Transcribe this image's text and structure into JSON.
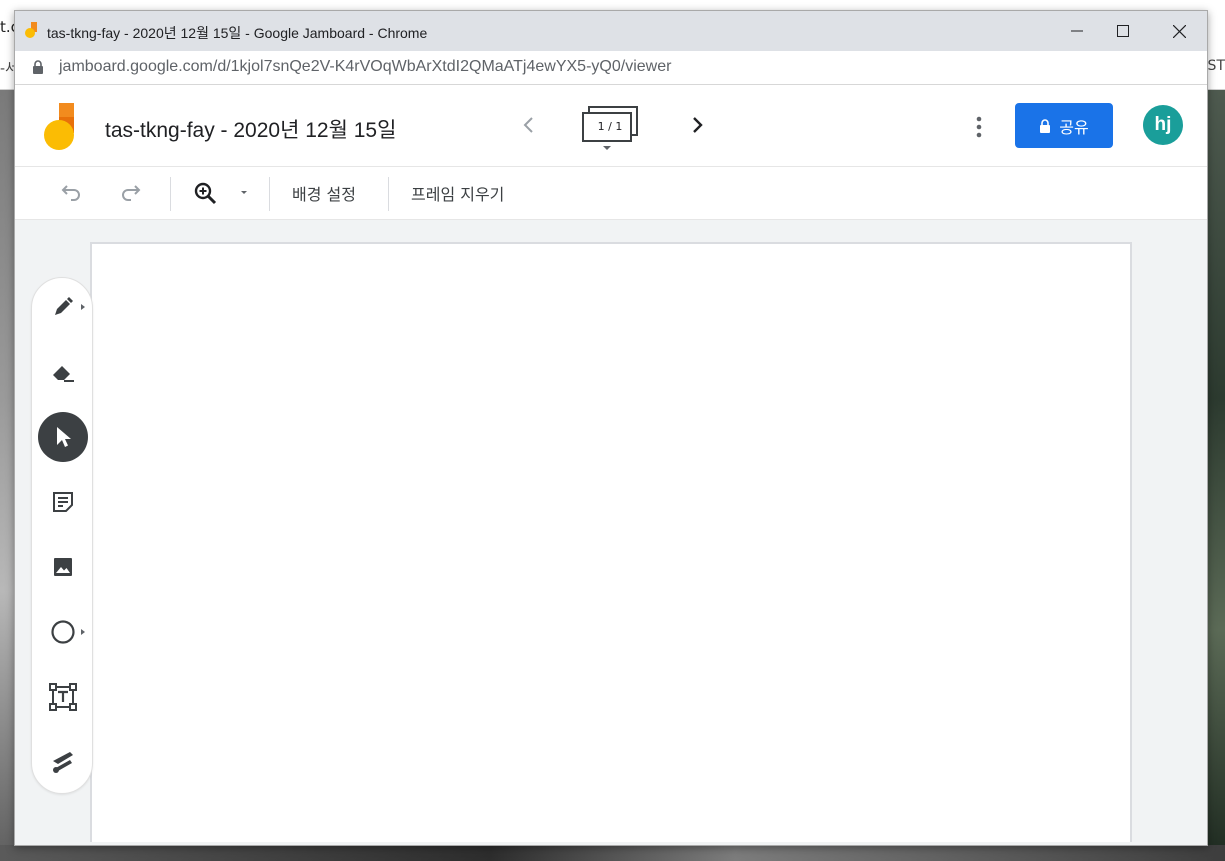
{
  "desktop": {
    "fragment_left_top": "t.c",
    "fragment_left_mid": "-서",
    "fragment_right_mid": "IST"
  },
  "browser": {
    "window_title": "tas-tkng-fay - 2020년 12월 15일 - Google Jamboard - Chrome",
    "url": "jamboard.google.com/d/1kjol7snQe2V-K4rVOqWbArXtdI2QMaATj4ewYX5-yQ0/viewer"
  },
  "app": {
    "doc_title": "tas-tkng-fay - 2020년 12월 15일",
    "frame_label": "1 / 1",
    "share_label": "공유",
    "avatar_initials": "hj",
    "colors": {
      "share": "#1a73e8",
      "avatar": "#1a9e9a",
      "logo_orange": "#f28b1e",
      "logo_yellow": "#fbbc04"
    }
  },
  "toolbar": {
    "undo_icon": "undo-icon",
    "redo_icon": "redo-icon",
    "zoom_icon": "zoom-in-icon",
    "background_label": "배경 설정",
    "clear_frame_label": "프레임 지우기"
  },
  "tools": [
    {
      "name": "pen",
      "icon": "pen-icon"
    },
    {
      "name": "eraser",
      "icon": "eraser-icon"
    },
    {
      "name": "select",
      "icon": "select-arrow-icon",
      "active": true
    },
    {
      "name": "sticky-note",
      "icon": "sticky-note-icon"
    },
    {
      "name": "image",
      "icon": "image-icon"
    },
    {
      "name": "circle",
      "icon": "circle-icon"
    },
    {
      "name": "text-box",
      "icon": "text-box-icon"
    },
    {
      "name": "laser",
      "icon": "laser-icon"
    }
  ]
}
